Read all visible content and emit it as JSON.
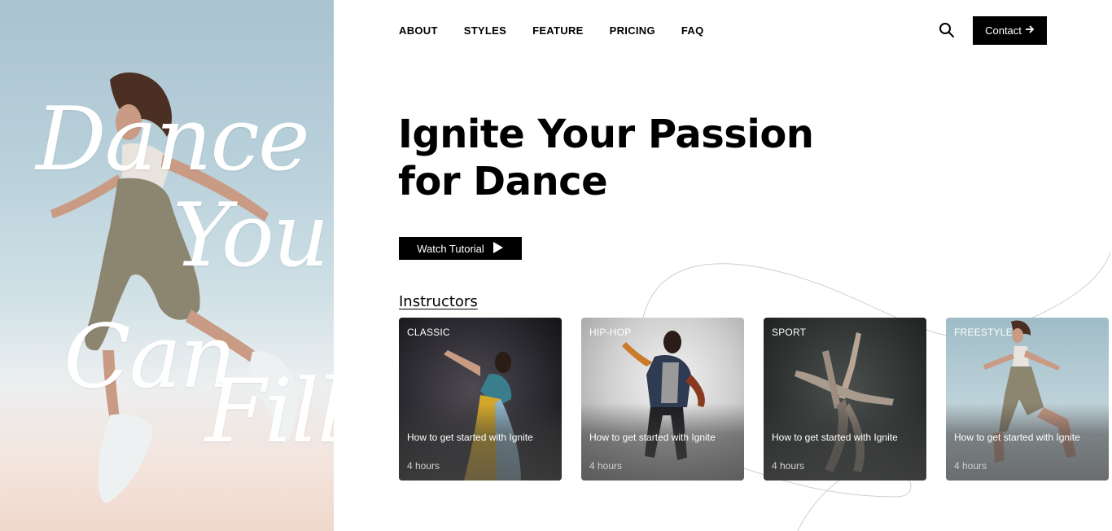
{
  "hero": {
    "script_words": [
      "Dance",
      "You",
      "Can",
      "Fill"
    ]
  },
  "nav": {
    "items": [
      "ABOUT",
      "STYLES",
      "FEATURE",
      "PRICING",
      "FAQ"
    ],
    "contact_label": "Contact",
    "search_icon": "search-icon",
    "contact_icon": "arrow-right-icon"
  },
  "headline": {
    "line1": "Ignite Your Passion",
    "line2": "for Dance"
  },
  "watch": {
    "label": "Watch Tutorial",
    "icon": "play-icon"
  },
  "instructors": {
    "title": "Instructors",
    "cards": [
      {
        "tag": "CLASSIC",
        "title": "How to get started with Ignite",
        "duration": "4 hours"
      },
      {
        "tag": "HIP-HOP",
        "title": "How to get started with Ignite",
        "duration": "4 hours"
      },
      {
        "tag": "SPORT",
        "title": "How to get started with Ignite",
        "duration": "4 hours"
      },
      {
        "tag": "FREESTYLE",
        "title": "How to get started with Ignite",
        "duration": "4 hours"
      }
    ]
  },
  "colors": {
    "button_bg": "#000000",
    "button_text": "#ffffff",
    "page_bg": "#ffffff"
  }
}
